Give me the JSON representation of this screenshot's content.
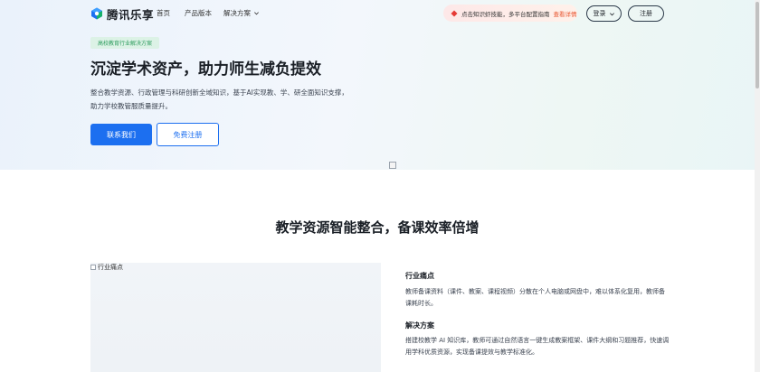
{
  "header": {
    "logo_text": "腾讯乐享",
    "nav": [
      {
        "label": "首页"
      },
      {
        "label": "产品版本"
      },
      {
        "label": "解决方案"
      }
    ],
    "notice": {
      "text": "点击知识虾技能，多平台配置指南",
      "link": "查看详情"
    },
    "login_label": "登录",
    "register_label": "注册"
  },
  "hero": {
    "tag": "高校教育行业解决方案",
    "title": "沉淀学术资产，助力师生减负提效",
    "desc_line1": "整合教学资源、行政管理与科研创新全域知识，基于AI实现教、学、研全面知识支撑，",
    "desc_line2": "助力学校教管服质量提升。",
    "contact_label": "联系我们",
    "free_register_label": "免费注册"
  },
  "section": {
    "title": "教学资源智能整合，备课效率倍增",
    "image_alt": "行业痛点",
    "pain_title": "行业痛点",
    "pain_text": "教师备课资料（课件、教案、课程视频）分散在个人电脑或网盘中，难以体系化复用，教师备课耗时长。",
    "solution_title": "解决方案",
    "solution_text": "搭建校教学 AI 知识库，教师可通过自然语言一键生成教案框架、课件大纲和习题推荐，快速调用学科优质资源，实现备课提效与教学标准化。"
  },
  "colors": {
    "primary": "#1c6ff0",
    "tag_bg": "#dcf2e6",
    "tag_text": "#2e9d5f",
    "notice_link": "#e8542f"
  }
}
